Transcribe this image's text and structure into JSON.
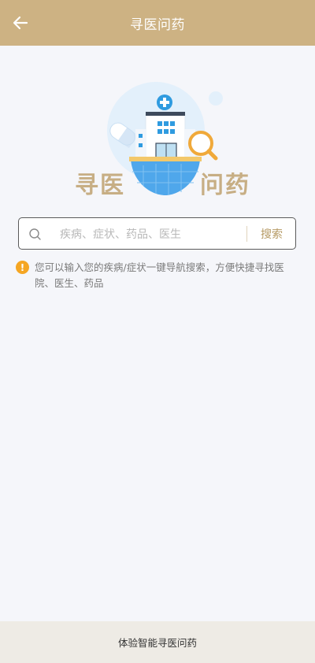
{
  "header": {
    "title": "寻医问药",
    "back_icon": "arrow-left-icon"
  },
  "hero": {
    "word_left": "寻医",
    "word_right": "问药"
  },
  "search": {
    "placeholder": "疾病、症状、药品、医生",
    "value": "",
    "button_label": "搜索",
    "icon": "search-icon"
  },
  "tip": {
    "icon": "warning-icon",
    "text": "您可以输入您的疾病/症状一键导航搜索，方便快捷寻找医院、医生、药品"
  },
  "footer": {
    "label": "体验智能寻医问药"
  },
  "colors": {
    "header_bg": "#cdb283",
    "accent_text": "#b69a64",
    "warning": "#f5a623",
    "page_bg": "#f5f6fa",
    "footer_bg": "#eeebe5"
  }
}
